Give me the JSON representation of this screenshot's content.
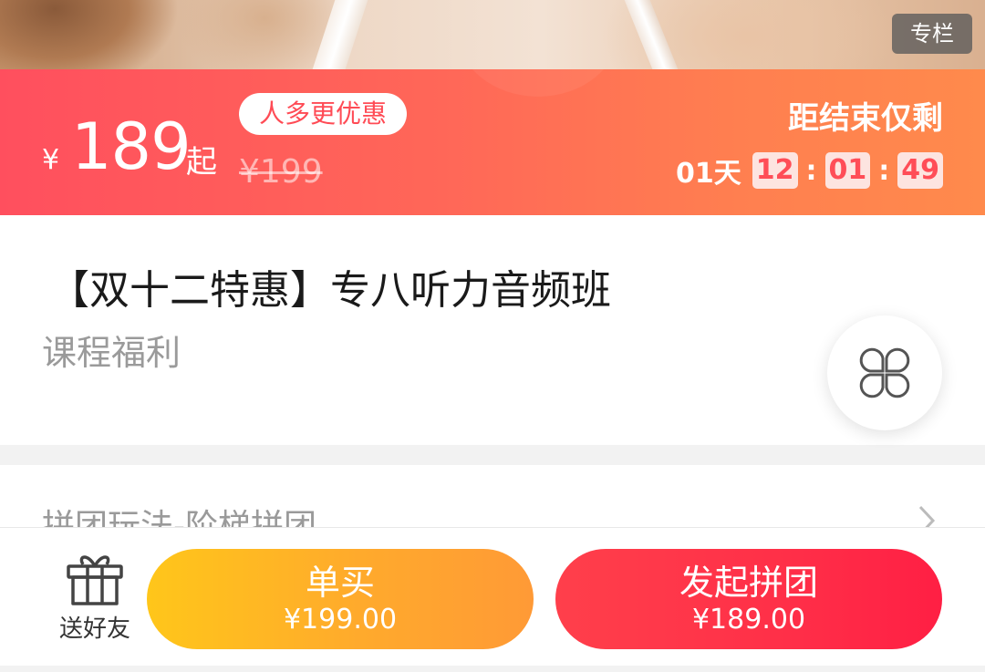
{
  "header": {
    "tag": "专栏"
  },
  "price_banner": {
    "currency": "¥",
    "price": "189",
    "price_suffix": "起",
    "promo": "人多更优惠",
    "original_price": "¥199",
    "countdown_label": "距结束仅剩",
    "countdown": {
      "days": "01天",
      "hours": "12",
      "minutes": "01",
      "seconds": "49",
      "separator": ":"
    }
  },
  "course": {
    "title": "【双十二特惠】专八听力音频班",
    "subtitle": "课程福利"
  },
  "group_rule": {
    "label": "拼团玩法-阶梯拼团"
  },
  "bottom_bar": {
    "gift_label": "送好友",
    "single_buy": {
      "label": "单买",
      "price": "¥199.00"
    },
    "group_buy": {
      "label": "发起拼团",
      "price": "¥189.00"
    }
  },
  "icons": {
    "menu": "clover-menu-icon",
    "gift": "gift-icon",
    "chevron": "chevron-right-icon"
  }
}
